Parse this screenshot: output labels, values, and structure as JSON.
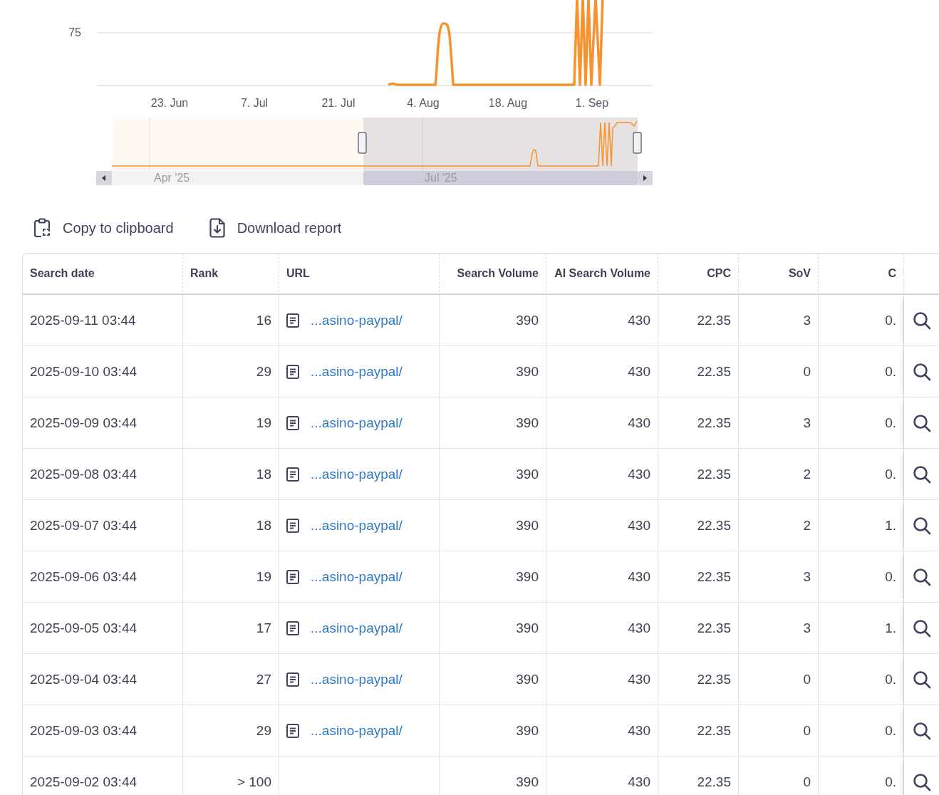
{
  "chart": {
    "y_tick": "75",
    "x_labels": [
      "23. Jun",
      "7. Jul",
      "21. Jul",
      "4. Aug",
      "18. Aug",
      "1. Sep"
    ],
    "navigator_labels": [
      "Apr '25",
      "Jul '25"
    ]
  },
  "toolbar": [
    {
      "kind": "copy",
      "label": "Copy to clipboard"
    },
    {
      "kind": "download",
      "label": "Download report"
    }
  ],
  "table": {
    "columns": [
      "Search date",
      "Rank",
      "URL",
      "Search Volume",
      "AI Search Volume",
      "CPC",
      "SoV",
      "C"
    ],
    "rows": [
      {
        "date": "2025-09-11 03:44",
        "rank": "16",
        "url": "...asino-paypal/",
        "search_volume": "390",
        "ai_search_volume": "430",
        "cpc": "22.35",
        "sov": "3",
        "column_8": "0."
      },
      {
        "date": "2025-09-10 03:44",
        "rank": "29",
        "url": "...asino-paypal/",
        "search_volume": "390",
        "ai_search_volume": "430",
        "cpc": "22.35",
        "sov": "0",
        "column_8": "0."
      },
      {
        "date": "2025-09-09 03:44",
        "rank": "19",
        "url": "...asino-paypal/",
        "search_volume": "390",
        "ai_search_volume": "430",
        "cpc": "22.35",
        "sov": "3",
        "column_8": "0."
      },
      {
        "date": "2025-09-08 03:44",
        "rank": "18",
        "url": "...asino-paypal/",
        "search_volume": "390",
        "ai_search_volume": "430",
        "cpc": "22.35",
        "sov": "2",
        "column_8": "0."
      },
      {
        "date": "2025-09-07 03:44",
        "rank": "18",
        "url": "...asino-paypal/",
        "search_volume": "390",
        "ai_search_volume": "430",
        "cpc": "22.35",
        "sov": "2",
        "column_8": "1."
      },
      {
        "date": "2025-09-06 03:44",
        "rank": "19",
        "url": "...asino-paypal/",
        "search_volume": "390",
        "ai_search_volume": "430",
        "cpc": "22.35",
        "sov": "3",
        "column_8": "0."
      },
      {
        "date": "2025-09-05 03:44",
        "rank": "17",
        "url": "...asino-paypal/",
        "search_volume": "390",
        "ai_search_volume": "430",
        "cpc": "22.35",
        "sov": "3",
        "column_8": "1."
      },
      {
        "date": "2025-09-04 03:44",
        "rank": "27",
        "url": "...asino-paypal/",
        "search_volume": "390",
        "ai_search_volume": "430",
        "cpc": "22.35",
        "sov": "0",
        "column_8": "0."
      },
      {
        "date": "2025-09-03 03:44",
        "rank": "29",
        "url": "...asino-paypal/",
        "search_volume": "390",
        "ai_search_volume": "430",
        "cpc": "22.35",
        "sov": "0",
        "column_8": "0."
      },
      {
        "date": "2025-09-02 03:44",
        "rank": "> 100",
        "search_volume": "390",
        "ai_search_volume": "430",
        "cpc": "22.35",
        "sov": "0",
        "column_8": "0."
      }
    ]
  }
}
